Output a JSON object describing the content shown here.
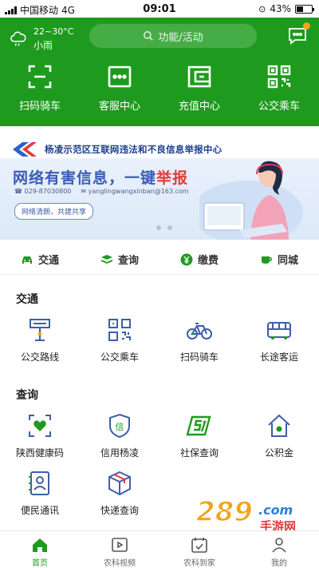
{
  "status_bar": {
    "carrier": "中国移动",
    "network": "4G",
    "time": "09:01",
    "battery": "43%"
  },
  "weather": {
    "temp": "22~30°C",
    "desc": "小雨"
  },
  "search": {
    "placeholder": "功能/活动"
  },
  "quick_actions": [
    {
      "label": "扫码骑车",
      "icon": "scan-icon"
    },
    {
      "label": "客服中心",
      "icon": "chat-icon"
    },
    {
      "label": "充值中心",
      "icon": "wallet-icon"
    },
    {
      "label": "公交乘车",
      "icon": "qr-code-icon"
    }
  ],
  "banner": {
    "title": "杨凌示范区互联网违法和不良信息举报中心",
    "headline": "网络有害信息，一键",
    "headline_hl": "举报",
    "phone": "029-87030800",
    "email": "yanglingwangxinban@163.com",
    "tag": "网络清朗，共建共享"
  },
  "tabs": [
    {
      "label": "交通",
      "icon": "car-icon"
    },
    {
      "label": "查询",
      "icon": "books-icon"
    },
    {
      "label": "缴费",
      "icon": "yen-icon"
    },
    {
      "label": "同城",
      "icon": "cup-icon"
    }
  ],
  "sections": {
    "traffic": {
      "title": "交通",
      "items": [
        {
          "label": "公交路线",
          "icon": "bus-stop-icon"
        },
        {
          "label": "公交乘车",
          "icon": "qr-code-icon"
        },
        {
          "label": "扫码骑车",
          "icon": "bicycle-icon"
        },
        {
          "label": "长途客运",
          "icon": "coach-icon"
        }
      ]
    },
    "query": {
      "title": "查询",
      "items": [
        {
          "label": "陕西健康码",
          "icon": "health-code-icon"
        },
        {
          "label": "信用杨凌",
          "icon": "shield-icon"
        },
        {
          "label": "社保查询",
          "icon": "social-security-icon"
        },
        {
          "label": "公积金",
          "icon": "house-icon"
        },
        {
          "label": "便民通讯",
          "icon": "contacts-icon"
        },
        {
          "label": "快递查询",
          "icon": "package-icon"
        }
      ]
    }
  },
  "bottom_nav": [
    {
      "label": "首页",
      "icon": "home-icon",
      "active": true
    },
    {
      "label": "农科视频",
      "icon": "video-icon"
    },
    {
      "label": "农科到家",
      "icon": "calendar-check-icon"
    },
    {
      "label": "我的",
      "icon": "user-icon"
    }
  ],
  "watermark": {
    "text": "289.com",
    "subtext": "手游网"
  },
  "colors": {
    "brand_green": "#1e9b1e",
    "icon_blue": "#3f5ea8",
    "icon_green": "#1e9b1e",
    "accent_orange": "#f1a31b"
  }
}
